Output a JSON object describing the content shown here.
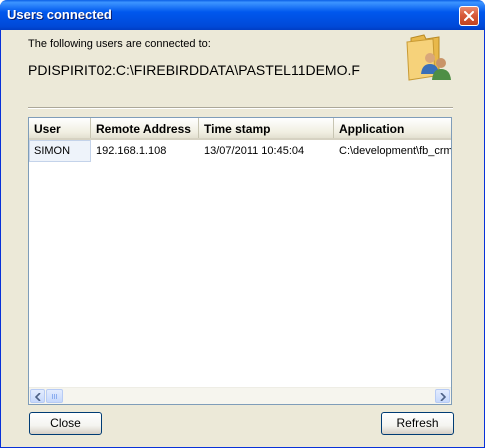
{
  "window": {
    "title": "Users connected",
    "close_icon": "close-icon"
  },
  "message": {
    "intro": "The following users are connected to:",
    "database_path": "PDISPIRIT02:C:\\FIREBIRDDATA\\PASTEL11DEMO.F"
  },
  "users_icon": "users-folder-icon",
  "table": {
    "columns": [
      "User",
      "Remote Address",
      "Time stamp",
      "Application"
    ],
    "rows": [
      {
        "user": "SIMON",
        "remote_address": "192.168.1.108",
        "timestamp": "13/07/2011 10:45:04",
        "application": "C:\\development\\fb_crm"
      }
    ]
  },
  "buttons": {
    "close_label": "Close",
    "refresh_label": "Refresh"
  },
  "colors": {
    "titlebar": "#0058EE",
    "dialog_background": "#ECE9D8",
    "close_button": "#D85A3A",
    "selected_cell": "#EEF3FA"
  }
}
